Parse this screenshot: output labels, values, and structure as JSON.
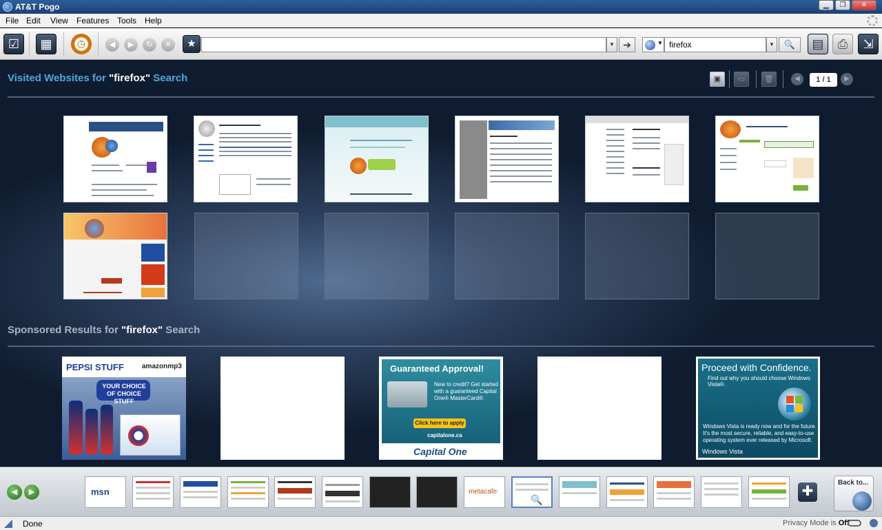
{
  "window": {
    "title": "AT&T Pogo",
    "buttons": [
      "minimize",
      "maximize",
      "close"
    ]
  },
  "menu": {
    "items": [
      "File",
      "Edit",
      "View",
      "Features",
      "Tools",
      "Help"
    ]
  },
  "toolbar": {
    "address_value": "",
    "search_value": "firefox",
    "search_engine_icon": "globe-icon"
  },
  "visited": {
    "label_prefix": "Visited Websites for",
    "query": "\"firefox\"",
    "label_suffix": "Search",
    "page": "1 / 1"
  },
  "sponsored": {
    "label_prefix": "Sponsored Results for",
    "query": "\"firefox\"",
    "label_suffix": "Search",
    "ads": [
      {
        "name": "pepsi",
        "text1": "PEPSI STUFF",
        "text2": "amazonmp3",
        "text3": "YOUR CHOICE OF CHOICE STUFF"
      },
      {
        "name": "blank-1"
      },
      {
        "name": "capital-one",
        "title": "Guaranteed Approval!",
        "body": "New to credit? Get started with a guaranteed Capital One® MasterCard®.",
        "button": "Click here to apply",
        "url": "capitalone.ca",
        "brand": "Capital One"
      },
      {
        "name": "blank-2"
      },
      {
        "name": "windows-vista",
        "title": "Proceed with Confidence.",
        "sub": "Find out why you should choose Windows Vista®.",
        "body": "Windows Vista is ready now and for the future. It's the most secure, reliable, and easy-to-use operating system ever released by Microsoft.",
        "brand": "Windows Vista"
      }
    ]
  },
  "thumbnails": [
    {
      "kind": "mozilla-org"
    },
    {
      "kind": "wikipedia"
    },
    {
      "kind": "mozilla-firefox-3"
    },
    {
      "kind": "article"
    },
    {
      "kind": "doc-page"
    },
    {
      "kind": "addons"
    },
    {
      "kind": "spread-firefox"
    },
    {
      "kind": "empty"
    },
    {
      "kind": "empty"
    },
    {
      "kind": "empty"
    },
    {
      "kind": "empty"
    },
    {
      "kind": "empty"
    }
  ],
  "strip": {
    "tabs": [
      "msn",
      "page",
      "page",
      "page",
      "page",
      "page",
      "comedy",
      "comedy",
      "metacafe",
      "search",
      "page",
      "page",
      "page",
      "page",
      "page"
    ],
    "back_to_label": "Back to..."
  },
  "status": {
    "text": "Done",
    "privacy_label": "Privacy Mode is",
    "privacy_value": "Off"
  }
}
